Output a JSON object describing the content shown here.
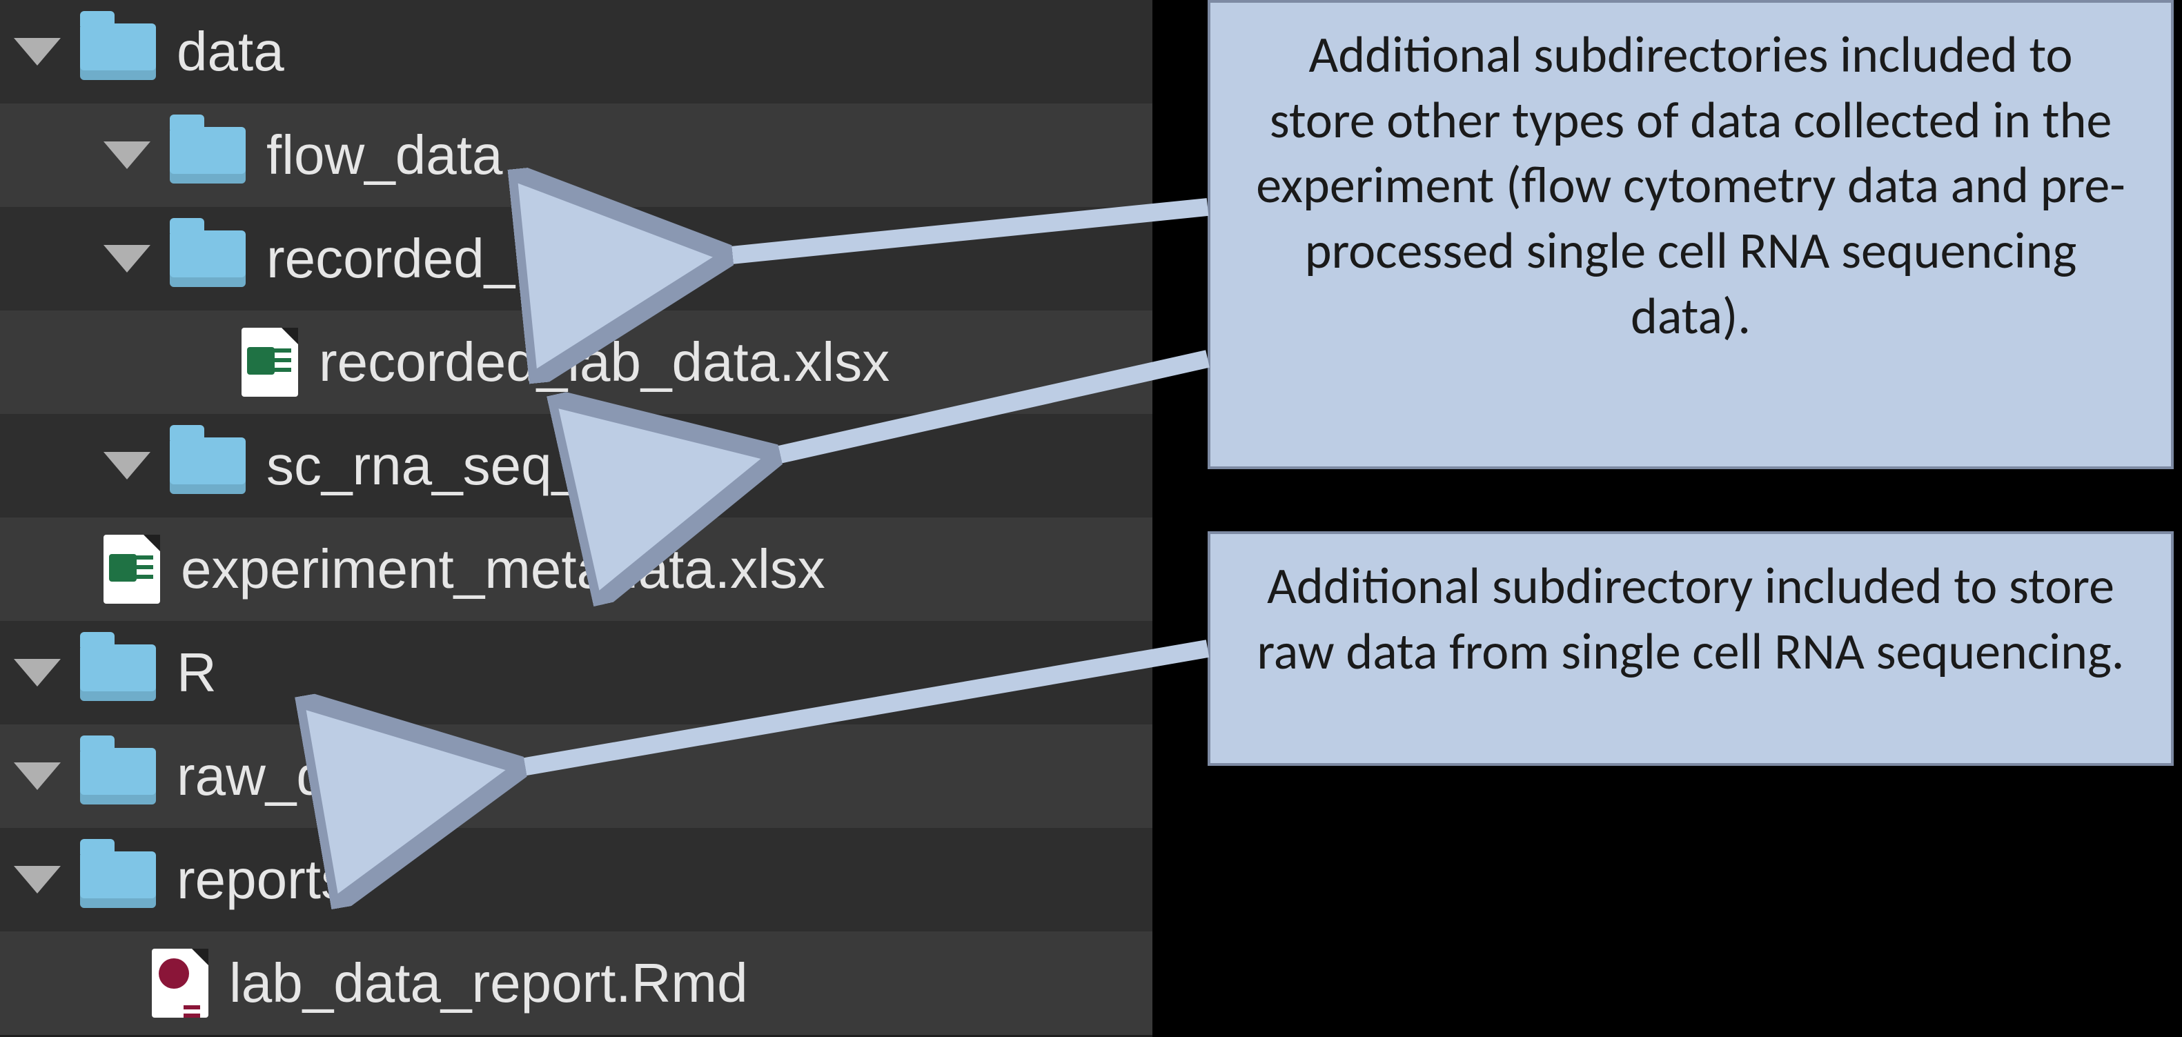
{
  "tree": {
    "data": "data",
    "flow_data": "flow_data",
    "recorded_data": "recorded_data",
    "recorded_lab_xlsx": "recorded_lab_data.xlsx",
    "sc_rna_seq_data": "sc_rna_seq_data",
    "experiment_xlsx": "experiment_metadata.xlsx",
    "r": "R",
    "raw_data": "raw_data",
    "reports": "reports",
    "lab_report_rmd": "lab_data_report.Rmd"
  },
  "callouts": {
    "c1": "Additional subdirectories included to store other types of data collected in the experiment (flow cytometry data and pre-processed single cell RNA sequencing data).",
    "c2": "Additional subdirectory included to store raw data from single cell RNA sequencing."
  }
}
